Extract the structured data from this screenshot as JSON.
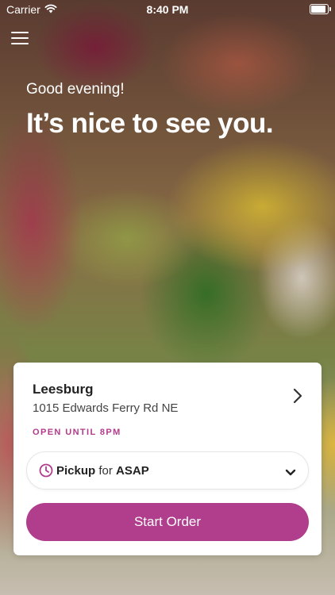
{
  "status_bar": {
    "carrier": "Carrier",
    "time": "8:40 PM"
  },
  "hero": {
    "greeting": "Good evening!",
    "headline": "It’s nice to see you."
  },
  "location": {
    "name": "Leesburg",
    "address": "1015 Edwards Ferry Rd NE",
    "hours": "OPEN UNTIL 8PM"
  },
  "order": {
    "mode": "Pickup",
    "for_word": "for",
    "time": "ASAP",
    "start_label": "Start Order"
  },
  "colors": {
    "accent": "#b13d8d",
    "hours_text": "#b23a8b"
  },
  "icons": [
    "wifi-icon",
    "battery-icon",
    "menu-icon",
    "chevron-right-icon",
    "clock-icon",
    "chevron-down-icon"
  ]
}
